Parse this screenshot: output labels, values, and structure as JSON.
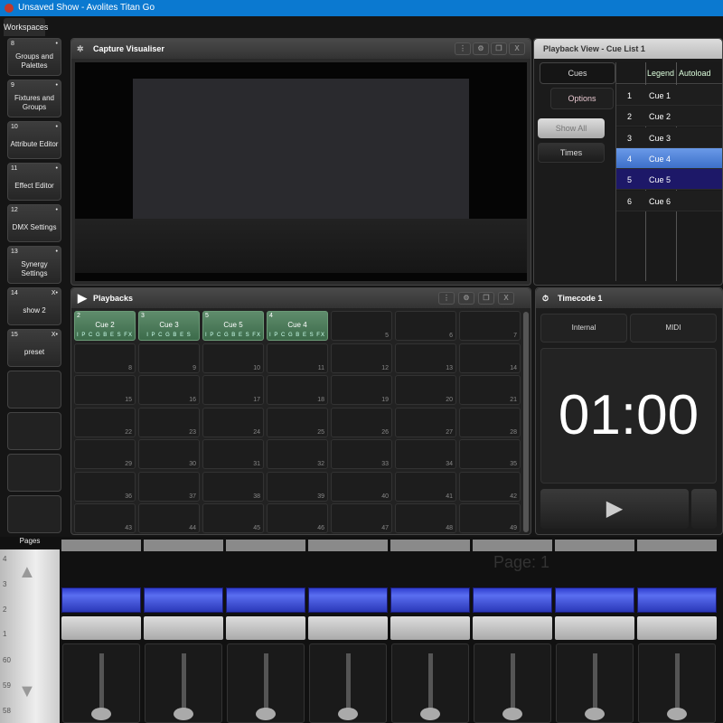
{
  "title": "Unsaved Show - Avolites Titan Go",
  "workspaces": {
    "tab": "Workspaces",
    "items": [
      {
        "n": "8",
        "label": "Groups and Palettes",
        "flag": "•"
      },
      {
        "n": "9",
        "label": "Fixtures and Groups",
        "flag": "•"
      },
      {
        "n": "10",
        "label": "Attribute Editor",
        "flag": "•"
      },
      {
        "n": "11",
        "label": "Effect Editor",
        "flag": "•"
      },
      {
        "n": "12",
        "label": "DMX Settings",
        "flag": "•"
      },
      {
        "n": "13",
        "label": "Synergy Settings",
        "flag": "•"
      },
      {
        "n": "14",
        "label": "show 2",
        "flag": "X•"
      },
      {
        "n": "15",
        "label": "preset",
        "flag": "X•"
      }
    ]
  },
  "visualiser": {
    "title": "Capture Visualiser",
    "close": "X"
  },
  "playback_view": {
    "title": "Playback View - Cue List 1",
    "tabs": [
      "Cues",
      "Options"
    ],
    "buttons": [
      "Show All",
      "Times"
    ],
    "columns": [
      "",
      "Legend",
      "Autoload"
    ],
    "rows": [
      {
        "n": "1",
        "legend": "Cue 1"
      },
      {
        "n": "2",
        "legend": "Cue 2"
      },
      {
        "n": "3",
        "legend": "Cue 3"
      },
      {
        "n": "4",
        "legend": "Cue 4"
      },
      {
        "n": "5",
        "legend": "Cue 5"
      },
      {
        "n": "6",
        "legend": "Cue 6"
      }
    ]
  },
  "playbacks": {
    "title": "Playbacks",
    "close": "X",
    "assigned": [
      {
        "n": "2",
        "label": "Cue 2",
        "flags": "I P C G B E S FX"
      },
      {
        "n": "3",
        "label": "Cue 3",
        "flags": "I P C G B E S"
      },
      {
        "n": "5",
        "label": "Cue 5",
        "flags": "I P C G B E S FX"
      },
      {
        "n": "4",
        "label": "Cue 4",
        "flags": "I P C G B E S FX"
      }
    ]
  },
  "timecode": {
    "title": "Timecode 1",
    "sources": [
      "Internal",
      "MIDI"
    ],
    "time": "01:00"
  },
  "pages": {
    "label": "Pages",
    "numbers": [
      "4",
      "3",
      "2",
      "1",
      "60",
      "59",
      "58"
    ],
    "current": "Page: 1"
  }
}
